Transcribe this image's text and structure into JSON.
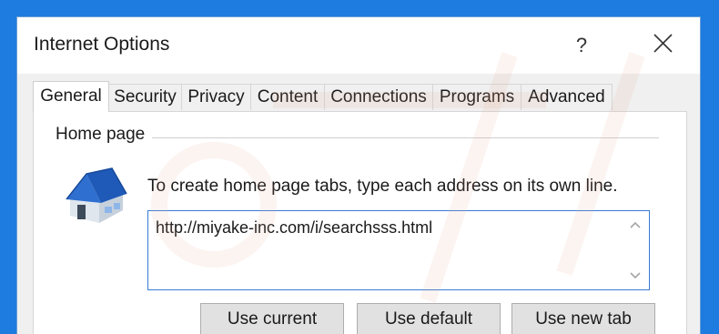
{
  "window": {
    "title": "Internet Options",
    "help_label": "?"
  },
  "tabs": [
    {
      "label": "General",
      "active": true
    },
    {
      "label": "Security",
      "active": false
    },
    {
      "label": "Privacy",
      "active": false
    },
    {
      "label": "Content",
      "active": false
    },
    {
      "label": "Connections",
      "active": false
    },
    {
      "label": "Programs",
      "active": false
    },
    {
      "label": "Advanced",
      "active": false
    }
  ],
  "home_page": {
    "group_label": "Home page",
    "instruction": "To create home page tabs, type each address on its own line.",
    "address_value": "http://miyake-inc.com/i/searchsss.html",
    "buttons": {
      "use_current": "Use current",
      "use_default": "Use default",
      "use_new_tab": "Use new tab"
    }
  },
  "colors": {
    "desktop_background": "#1e7be0",
    "focus_border": "#3a7bd5",
    "house_roof": "#2f6fd0"
  }
}
